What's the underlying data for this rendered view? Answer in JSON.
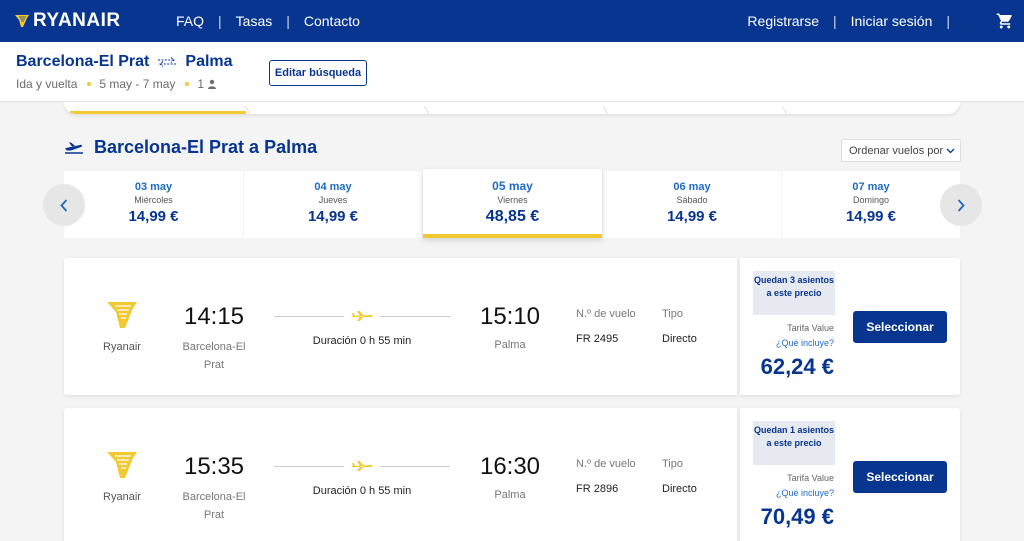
{
  "nav": {
    "brand": "RYANAIR",
    "links": [
      "FAQ",
      "Tasas",
      "Contacto"
    ],
    "register": "Registrarse",
    "login": "Iniciar sesión"
  },
  "search": {
    "origin": "Barcelona-El Prat",
    "destination": "Palma",
    "trip_type": "Ida y vuelta",
    "dates": "5 may - 7 may",
    "passengers": "1",
    "edit_label": "Editar búsqueda"
  },
  "section": {
    "title": "Barcelona-El Prat a Palma",
    "sort_label": "Ordenar vuelos por"
  },
  "date_options": [
    {
      "date": "03 may",
      "weekday": "Miércoles",
      "price": "14,99 €"
    },
    {
      "date": "04 may",
      "weekday": "Jueves",
      "price": "14,99 €"
    },
    {
      "date": "05 may",
      "weekday": "Viernes",
      "price": "48,85 €",
      "selected": true
    },
    {
      "date": "06 may",
      "weekday": "Sábado",
      "price": "14,99 €"
    },
    {
      "date": "07 may",
      "weekday": "Domingo",
      "price": "14,99 €"
    }
  ],
  "labels": {
    "flight_no": "N.º de vuelo",
    "type": "Tipo",
    "fare": "Tarifa Value",
    "includes": "¿Qué incluye?",
    "select": "Seleccionar"
  },
  "flights": [
    {
      "airline": "Ryanair",
      "dep_time": "14:15",
      "dep_city": "Barcelona-El Prat",
      "duration": "Duración 0 h 55 min",
      "arr_time": "15:10",
      "arr_city": "Palma",
      "flight_no": "FR 2495",
      "type": "Directo",
      "seats_left": "Quedan 3 asientos a este precio",
      "price": "62,24 €"
    },
    {
      "airline": "Ryanair",
      "dep_time": "15:35",
      "dep_city": "Barcelona-El Prat",
      "duration": "Duración 0 h 55 min",
      "arr_time": "16:30",
      "arr_city": "Palma",
      "flight_no": "FR 2896",
      "type": "Directo",
      "seats_left": "Quedan 1 asientos a este precio",
      "price": "70,49 €"
    }
  ],
  "colors": {
    "brand_blue": "#073590",
    "accent_yellow": "#f1c933",
    "link_blue": "#1f6bc4",
    "background": "#f4f4f4"
  }
}
